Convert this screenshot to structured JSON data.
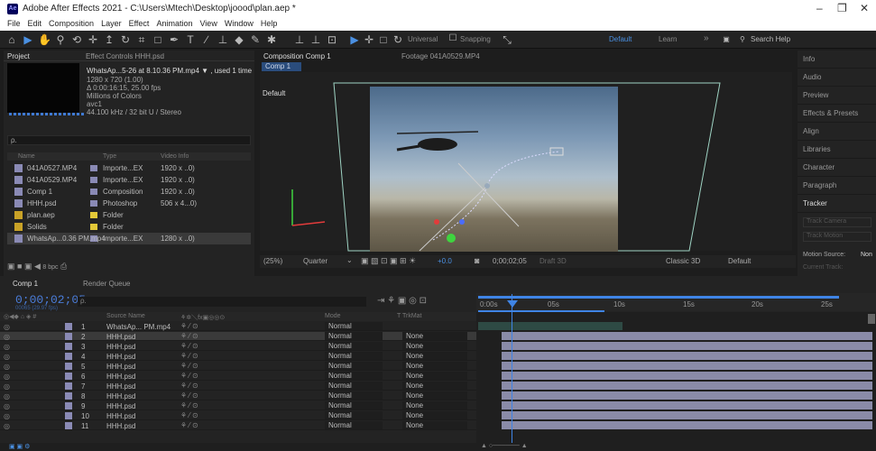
{
  "app": {
    "title": "Adobe After Effects 2021 - C:\\Users\\Mtech\\Desktop\\joood\\plan.aep *",
    "logo": "Ae"
  },
  "menu": [
    "File",
    "Edit",
    "Composition",
    "Layer",
    "Effect",
    "Animation",
    "View",
    "Window",
    "Help"
  ],
  "toolbar": {
    "universal": "Universal",
    "snapping": "Snapping",
    "workspace": "Default",
    "learn": "Learn",
    "search": "Search Help"
  },
  "project": {
    "tab": "Project",
    "tab2": "Effect Controls HHH.psd",
    "selected_name": "WhatsAp...5-26 at 8.10.36 PM.mp4 ▼ , used 1 time",
    "line1": "1280 x 720 (1.00)",
    "line2": "Δ 0:00:16:15, 25.00 fps",
    "line3": "Millions of Colors",
    "line4": "avc1",
    "line5": "44.100 kHz / 32 bit U / Stereo",
    "search_placeholder": "ρ.",
    "columns": [
      "Name",
      "Type",
      "Video Info"
    ],
    "items": [
      {
        "name": "041A0527.MP4",
        "type": "Importe...EX",
        "video": "1920 x ..0)",
        "color": "#8a8ab5"
      },
      {
        "name": "041A0529.MP4",
        "type": "Importe...EX",
        "video": "1920 x ..0)",
        "color": "#8a8ab5"
      },
      {
        "name": "Comp 1",
        "type": "Composition",
        "video": "1920 x ..0)",
        "color": "#8a8ab5"
      },
      {
        "name": "HHH.psd",
        "type": "Photoshop",
        "video": "506 x 4...0)",
        "color": "#8a8ab5"
      },
      {
        "name": "plan.aep",
        "type": "Folder",
        "video": "",
        "color": "#e3c938"
      },
      {
        "name": "Solids",
        "type": "Folder",
        "video": "",
        "color": "#e3c938"
      },
      {
        "name": "WhatsAp...0.36 PM.mp4",
        "type": "Importe...EX",
        "video": "1280 x ..0)",
        "color": "#8a8ab5"
      }
    ],
    "bpc": "8 bpc"
  },
  "comp": {
    "tab": "Composition Comp 1",
    "tab2": "Footage 041A0529.MP4",
    "subtab": "Comp 1",
    "view_label": "Default",
    "zoom": "(25%)",
    "quality": "Quarter",
    "exposure": "+0.0",
    "timecode": "0;00;02;05",
    "draft": "Draft 3D",
    "renderer": "Classic 3D",
    "view": "Default"
  },
  "right_panel": [
    "Info",
    "Audio",
    "Preview",
    "Effects & Presets",
    "Align",
    "Libraries",
    "Character",
    "Paragraph",
    "Tracker"
  ],
  "tracker": {
    "track_camera": "Track Camera",
    "track_motion": "Track Motion",
    "motion_source": "Motion Source:",
    "motion_value": "Non",
    "current_track": "Current Track:"
  },
  "timeline": {
    "tab": "Comp 1",
    "tab2": "Render Queue",
    "timecode": "0;00;02;05",
    "fps": "00065 (29.97 fps)",
    "headers": {
      "source": "Source Name",
      "mode": "Mode",
      "trkmat": "T  TrkMat"
    },
    "ruler": [
      "0:00s",
      "05s",
      "10s",
      "15s",
      "20s",
      "25s"
    ],
    "layers": [
      {
        "num": "1",
        "name": "WhatsAp... PM.mp4",
        "mode": "Normal",
        "trkmat": ""
      },
      {
        "num": "2",
        "name": "HHH.psd",
        "mode": "Normal",
        "trkmat": "None"
      },
      {
        "num": "3",
        "name": "HHH.psd",
        "mode": "Normal",
        "trkmat": "None"
      },
      {
        "num": "4",
        "name": "HHH.psd",
        "mode": "Normal",
        "trkmat": "None"
      },
      {
        "num": "5",
        "name": "HHH.psd",
        "mode": "Normal",
        "trkmat": "None"
      },
      {
        "num": "6",
        "name": "HHH.psd",
        "mode": "Normal",
        "trkmat": "None"
      },
      {
        "num": "7",
        "name": "HHH.psd",
        "mode": "Normal",
        "trkmat": "None"
      },
      {
        "num": "8",
        "name": "HHH.psd",
        "mode": "Normal",
        "trkmat": "None"
      },
      {
        "num": "9",
        "name": "HHH.psd",
        "mode": "Normal",
        "trkmat": "None"
      },
      {
        "num": "10",
        "name": "HHH.psd",
        "mode": "Normal",
        "trkmat": "None"
      },
      {
        "num": "11",
        "name": "HHH.psd",
        "mode": "Normal",
        "trkmat": "None"
      }
    ]
  }
}
